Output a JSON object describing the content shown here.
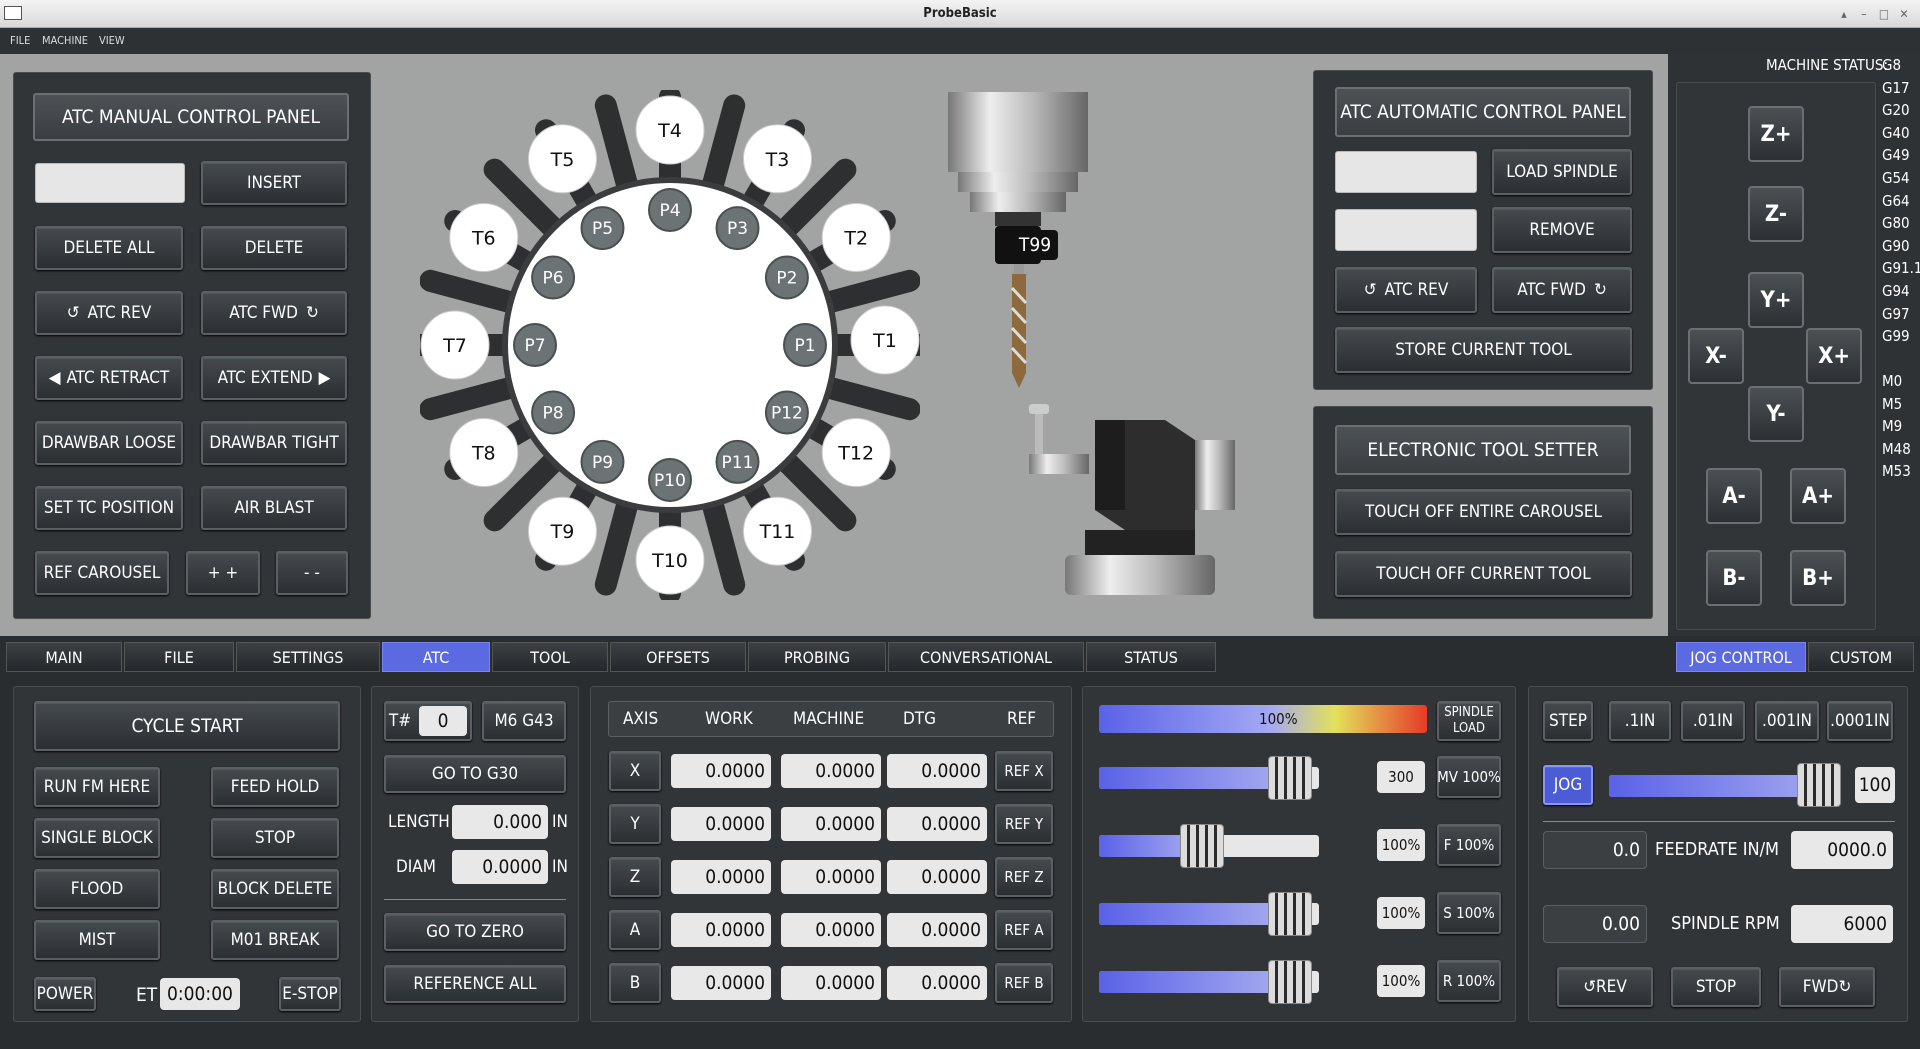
{
  "window": {
    "title": "ProbeBasic"
  },
  "menu": [
    "FILE",
    "MACHINE",
    "VIEW"
  ],
  "atc_manual": {
    "title": "ATC MANUAL CONTROL PANEL",
    "insert": "INSERT",
    "delete_all": "DELETE ALL",
    "delete": "DELETE",
    "atc_rev": "ATC REV",
    "atc_fwd": "ATC FWD",
    "atc_retract": "ATC RETRACT",
    "atc_extend": "ATC EXTEND",
    "drawbar_loose": "DRAWBAR LOOSE",
    "drawbar_tight": "DRAWBAR TIGHT",
    "set_tc": "SET TC POSITION",
    "air_blast": "AIR BLAST",
    "ref_carousel": "REF CAROUSEL",
    "plus": "+ +",
    "minus": "- -"
  },
  "carousel": {
    "tools": [
      "T1",
      "T2",
      "T3",
      "T4",
      "T5",
      "T6",
      "T7",
      "T8",
      "T9",
      "T10",
      "T11",
      "T12"
    ],
    "pockets": [
      "P1",
      "P2",
      "P3",
      "P4",
      "P5",
      "P6",
      "P7",
      "P8",
      "P9",
      "P10",
      "P11",
      "P12"
    ]
  },
  "spindle_tool": "T99",
  "atc_auto": {
    "title": "ATC AUTOMATIC CONTROL PANEL",
    "load_spindle": "LOAD SPINDLE",
    "remove": "REMOVE",
    "atc_rev": "ATC REV",
    "atc_fwd": "ATC FWD",
    "store": "STORE CURRENT TOOL"
  },
  "tool_setter": {
    "title": "ELECTRONIC TOOL SETTER",
    "touch_all": "TOUCH OFF ENTIRE CAROUSEL",
    "touch_current": "TOUCH OFF CURRENT TOOL"
  },
  "status": {
    "label": "MACHINE STATUS:",
    "gcodes": [
      "G8",
      "G17",
      "G20",
      "G40",
      "G49",
      "G54",
      "G64",
      "G80",
      "G90",
      "G91.1",
      "G94",
      "G97",
      "G99"
    ],
    "mcodes": [
      "M0",
      "M5",
      "M9",
      "M48",
      "M53"
    ]
  },
  "jog_buttons": {
    "zp": "Z+",
    "zm": "Z-",
    "yp": "Y+",
    "ym": "Y-",
    "xm": "X-",
    "xp": "X+",
    "am": "A-",
    "ap": "A+",
    "bm": "B-",
    "bp": "B+"
  },
  "tabs": [
    "MAIN",
    "FILE",
    "SETTINGS",
    "ATC",
    "TOOL",
    "OFFSETS",
    "PROBING",
    "CONVERSATIONAL",
    "STATUS"
  ],
  "right_tabs": [
    "JOG CONTROL",
    "CUSTOM"
  ],
  "cycle": {
    "start": "CYCLE START",
    "run_here": "RUN FM HERE",
    "feed_hold": "FEED HOLD",
    "single_block": "SINGLE BLOCK",
    "stop": "STOP",
    "flood": "FLOOD",
    "block_delete": "BLOCK DELETE",
    "mist": "MIST",
    "m01": "M01 BREAK",
    "power": "POWER",
    "et_label": "ET",
    "et_value": "0:00:00",
    "estop": "E-STOP"
  },
  "tool": {
    "t_label": "T#",
    "t_value": "0",
    "m6": "M6 G43",
    "g30": "GO TO G30",
    "length_label": "LENGTH",
    "length_value": "0.000",
    "diam_label": "DIAM",
    "diam_value": "0.0000",
    "unit": "IN",
    "go_zero": "GO TO ZERO",
    "ref_all": "REFERENCE ALL"
  },
  "dro": {
    "headers": [
      "AXIS",
      "WORK",
      "MACHINE",
      "DTG",
      "REF"
    ],
    "rows": [
      {
        "axis": "X",
        "work": "0.0000",
        "machine": "0.0000",
        "dtg": "0.0000",
        "ref": "REF X"
      },
      {
        "axis": "Y",
        "work": "0.0000",
        "machine": "0.0000",
        "dtg": "0.0000",
        "ref": "REF Y"
      },
      {
        "axis": "Z",
        "work": "0.0000",
        "machine": "0.0000",
        "dtg": "0.0000",
        "ref": "REF Z"
      },
      {
        "axis": "A",
        "work": "0.0000",
        "machine": "0.0000",
        "dtg": "0.0000",
        "ref": "REF A"
      },
      {
        "axis": "B",
        "work": "0.0000",
        "machine": "0.0000",
        "dtg": "0.0000",
        "ref": "REF B"
      }
    ]
  },
  "overrides": {
    "load_value": "100%",
    "load_label1": "SPINDLE",
    "load_label2": "LOAD",
    "mv_value": "300",
    "mv_btn": "MV 100%",
    "f_value": "100%",
    "f_btn": "F 100%",
    "s_value": "100%",
    "s_btn": "S 100%",
    "r_value": "100%",
    "r_btn": "R 100%"
  },
  "jogctl": {
    "step": "STEP",
    "s1": ".1IN",
    "s2": ".01IN",
    "s3": ".001IN",
    "s4": ".0001IN",
    "jog": "JOG",
    "jog_value": "100",
    "feed_actual": "0.0",
    "feed_label": "FEEDRATE IN/M",
    "feed_set": "0000.0",
    "rpm_actual": "0.00",
    "rpm_label": "SPINDLE RPM",
    "rpm_set": "6000",
    "rev": "REV",
    "stop": "STOP",
    "fwd": "FWD"
  }
}
